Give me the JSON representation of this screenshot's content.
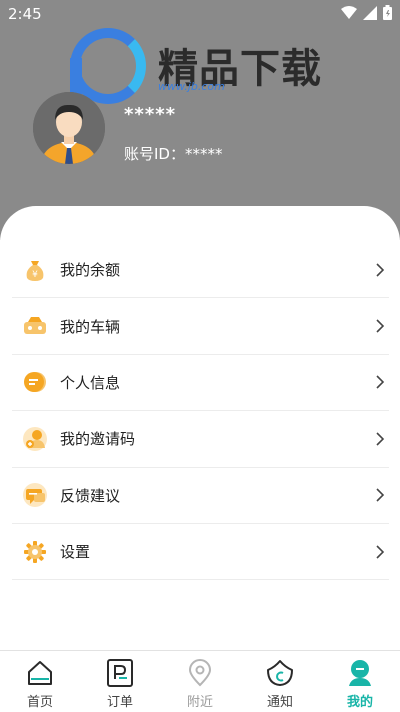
{
  "status_bar": {
    "time": "2:45"
  },
  "watermark": {
    "title": "精品下载",
    "url": "www.jb.com"
  },
  "profile": {
    "username": "*****",
    "account_label": "账号ID：*****"
  },
  "menu": [
    {
      "label": "我的余额",
      "icon": "money-bag-icon"
    },
    {
      "label": "我的车辆",
      "icon": "car-icon"
    },
    {
      "label": "个人信息",
      "icon": "info-icon"
    },
    {
      "label": "我的邀请码",
      "icon": "invite-icon"
    },
    {
      "label": "反馈建议",
      "icon": "feedback-icon"
    },
    {
      "label": "设置",
      "icon": "gear-icon"
    }
  ],
  "tabs": [
    {
      "label": "首页",
      "icon": "home-icon",
      "active": false
    },
    {
      "label": "订单",
      "icon": "order-icon",
      "active": false
    },
    {
      "label": "附近",
      "icon": "location-icon",
      "active": false
    },
    {
      "label": "通知",
      "icon": "notification-icon",
      "active": false
    },
    {
      "label": "我的",
      "icon": "profile-icon",
      "active": true
    }
  ],
  "colors": {
    "accent": "#19b5a8",
    "header_bg": "#8a8a8a",
    "icon_orange": "#f5a623"
  }
}
